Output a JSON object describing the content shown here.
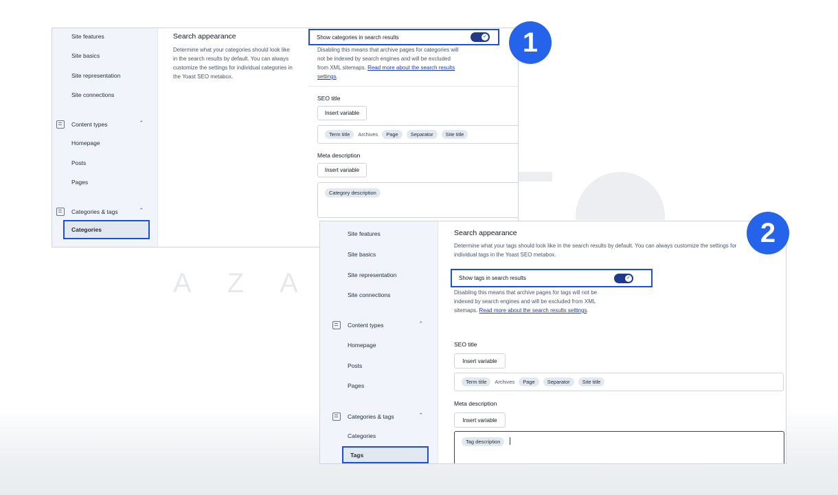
{
  "badges": [
    "1",
    "2"
  ],
  "panel1": {
    "nav": {
      "site_features": "Site features",
      "site_basics": "Site basics",
      "site_representation": "Site representation",
      "site_connections": "Site connections",
      "content_types": "Content types",
      "homepage": "Homepage",
      "posts": "Posts",
      "pages": "Pages",
      "categories_tags": "Categories & tags",
      "active": "Categories"
    },
    "section_title": "Search appearance",
    "section_desc": "Determine what your categories should look like in the search results by default. You can always customize the settings for individual categories in the Yoast SEO metabox.",
    "toggle_label": "Show categories in search results",
    "toggle_on": true,
    "help_text": "Disabling this means that archive pages for categories will not be indexed by search engines and will be excluded from XML sitemaps.",
    "help_link": "Read more about the search results settings",
    "seo_title_label": "SEO title",
    "insert_variable": "Insert variable",
    "seo_chips": [
      "Term title",
      "Page",
      "Separator",
      "Site title"
    ],
    "seo_plain": "Archives",
    "meta_label": "Meta description",
    "meta_chip": "Category description"
  },
  "panel2": {
    "nav": {
      "site_features": "Site features",
      "site_basics": "Site basics",
      "site_representation": "Site representation",
      "site_connections": "Site connections",
      "content_types": "Content types",
      "homepage": "Homepage",
      "posts": "Posts",
      "pages": "Pages",
      "categories_tags": "Categories & tags",
      "categories": "Categories",
      "active": "Tags"
    },
    "section_title": "Search appearance",
    "section_desc": "Determine what your tags should look like in the search results by default. You can always customize the settings for individual tags in the Yoast SEO metabox.",
    "toggle_label": "Show tags in search results",
    "toggle_on": true,
    "help_text": "Disabling this means that archive pages for tags will not be indexed by search engines and will be excluded from XML sitemaps.",
    "help_link": "Read more about the search results settings",
    "seo_title_label": "SEO title",
    "insert_variable": "Insert variable",
    "seo_chips": [
      "Term title",
      "Page",
      "Separator",
      "Site title"
    ],
    "seo_plain": "Archives",
    "meta_label": "Meta description",
    "meta_chip": "Tag description"
  },
  "watermark_text": "AZA",
  "colors": {
    "accent": "#1d4ed8",
    "badge": "#2563eb",
    "toggle": "#1e3a8a"
  }
}
